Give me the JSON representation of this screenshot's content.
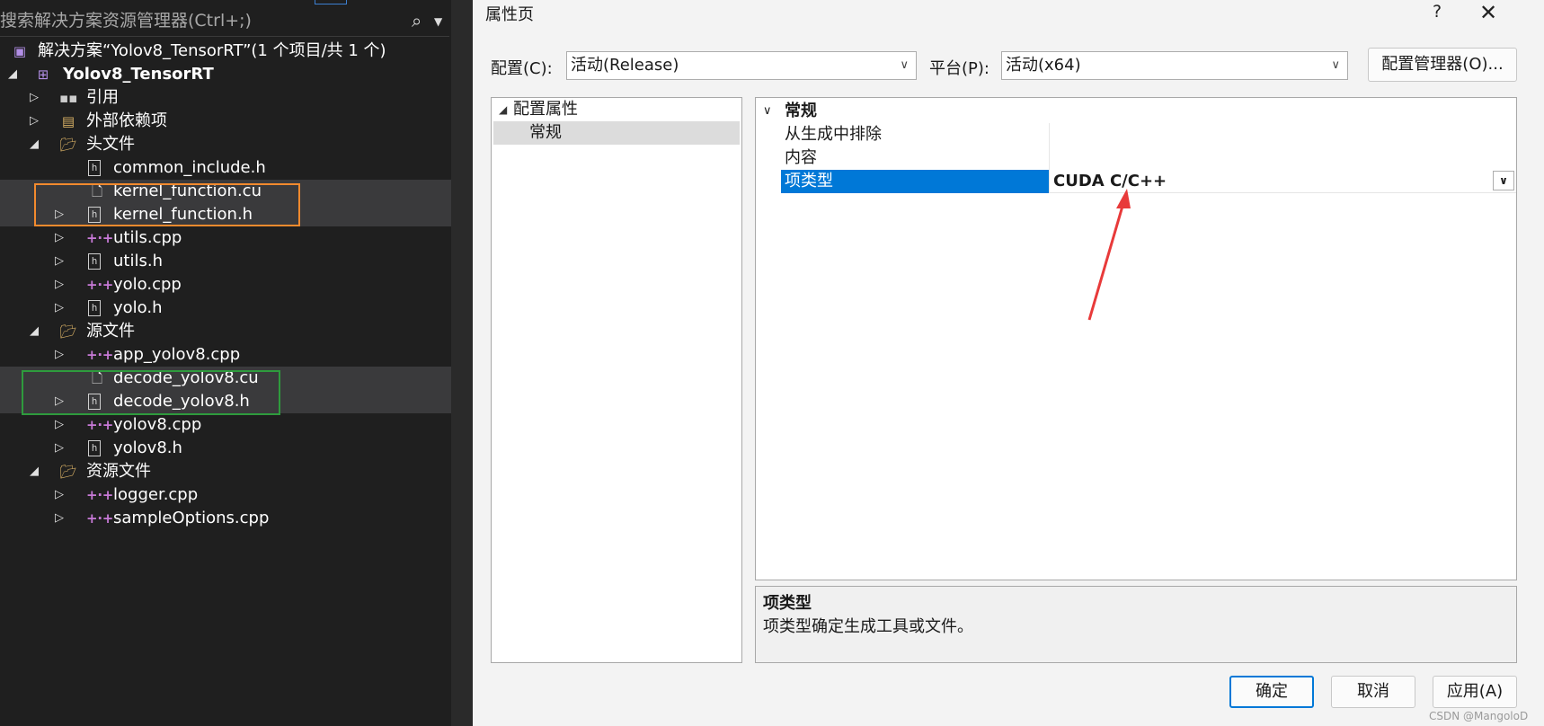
{
  "solution_explorer": {
    "search_placeholder": "搜索解决方案资源管理器(Ctrl+;)",
    "solution_label": "解决方案“Yolov8_TensorRT”(1 个项目/共 1 个)",
    "project_label": "Yolov8_TensorRT",
    "items": [
      {
        "label": "引用",
        "icon": "reference-icon"
      },
      {
        "label": "外部依赖项",
        "icon": "external-deps-icon"
      },
      {
        "label": "头文件",
        "icon": "folder-icon"
      },
      {
        "label": "common_include.h",
        "icon": "header-file-icon"
      },
      {
        "label": "kernel_function.cu",
        "icon": "file-icon"
      },
      {
        "label": "kernel_function.h",
        "icon": "header-file-icon"
      },
      {
        "label": "utils.cpp",
        "icon": "cpp-file-icon"
      },
      {
        "label": "utils.h",
        "icon": "header-file-icon"
      },
      {
        "label": "yolo.cpp",
        "icon": "cpp-file-icon"
      },
      {
        "label": "yolo.h",
        "icon": "header-file-icon"
      },
      {
        "label": "源文件",
        "icon": "folder-icon"
      },
      {
        "label": "app_yolov8.cpp",
        "icon": "cpp-file-icon"
      },
      {
        "label": "decode_yolov8.cu",
        "icon": "file-icon"
      },
      {
        "label": "decode_yolov8.h",
        "icon": "header-file-icon"
      },
      {
        "label": "yolov8.cpp",
        "icon": "cpp-file-icon"
      },
      {
        "label": "yolov8.h",
        "icon": "header-file-icon"
      },
      {
        "label": "资源文件",
        "icon": "folder-icon"
      },
      {
        "label": "logger.cpp",
        "icon": "cpp-file-icon"
      },
      {
        "label": "sampleOptions.cpp",
        "icon": "cpp-file-icon"
      }
    ]
  },
  "dialog": {
    "title": "属性页",
    "help": "?",
    "close": "✕",
    "config_label": "配置(C):",
    "config_value": "活动(Release)",
    "platform_label": "平台(P):",
    "platform_value": "活动(x64)",
    "config_manager_button": "配置管理器(O)...",
    "tree": {
      "root": "配置属性",
      "child": "常规"
    },
    "grid": {
      "category": "常规",
      "rows": [
        {
          "name": "从生成中排除",
          "value": ""
        },
        {
          "name": "内容",
          "value": ""
        },
        {
          "name": "项类型",
          "value": "CUDA C/C++"
        }
      ]
    },
    "description": {
      "title": "项类型",
      "text": "项类型确定生成工具或文件。"
    },
    "buttons": {
      "ok": "确定",
      "cancel": "取消",
      "apply": "应用(A)"
    }
  },
  "watermark": "CSDN @MangoloD",
  "colors": {
    "explorer_bg": "#1f1f1f",
    "dialog_bg": "#f3f3f3",
    "selection_blue": "#0078d7",
    "highlight_orange": "#f28a2e",
    "highlight_green": "#2e9b3d",
    "arrow_red": "#e83a3a"
  }
}
